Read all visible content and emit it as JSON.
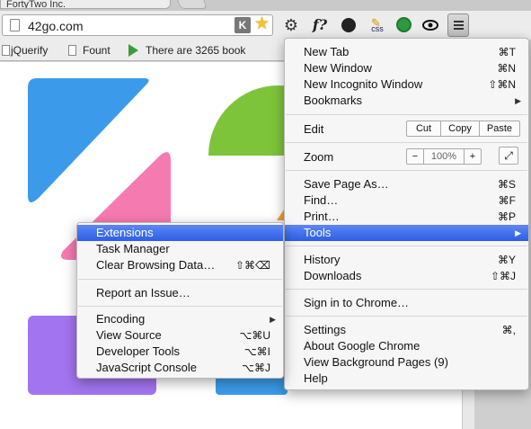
{
  "tab": {
    "title": "FortyTwo Inc.",
    "close": "×"
  },
  "omnibox": {
    "url": "42go.com",
    "k_badge": "K",
    "star": "☆"
  },
  "extensions": {
    "gear": "⚙",
    "fx": "f?",
    "css": "css",
    "eye": "👁"
  },
  "bookmarks": [
    {
      "label": "jQuerify"
    },
    {
      "label": "Fount"
    },
    {
      "label": "There are 3265 book"
    }
  ],
  "colors": {
    "blue": "#3b9bea",
    "green": "#7ec43a",
    "pink": "#f57ab0",
    "purple": "#a374f0",
    "orange": "#f6a23a",
    "highlight": "#3b6cf0"
  },
  "main_menu": {
    "new_tab": {
      "label": "New Tab",
      "shortcut": "⌘T"
    },
    "new_window": {
      "label": "New Window",
      "shortcut": "⌘N"
    },
    "new_incognito": {
      "label": "New Incognito Window",
      "shortcut": "⇧⌘N"
    },
    "bookmarks": {
      "label": "Bookmarks",
      "arrow": "▶"
    },
    "edit": {
      "label": "Edit",
      "cut": "Cut",
      "copy": "Copy",
      "paste": "Paste"
    },
    "zoom": {
      "label": "Zoom",
      "minus": "−",
      "value": "100%",
      "plus": "+",
      "fullscreen": "⤢"
    },
    "save_page": {
      "label": "Save Page As…",
      "shortcut": "⌘S"
    },
    "find": {
      "label": "Find…",
      "shortcut": "⌘F"
    },
    "print": {
      "label": "Print…",
      "shortcut": "⌘P"
    },
    "tools": {
      "label": "Tools",
      "arrow": "▶"
    },
    "history": {
      "label": "History",
      "shortcut": "⌘Y"
    },
    "downloads": {
      "label": "Downloads",
      "shortcut": "⇧⌘J"
    },
    "sign_in": {
      "label": "Sign in to Chrome…"
    },
    "settings": {
      "label": "Settings",
      "shortcut": "⌘,"
    },
    "about": {
      "label": "About Google Chrome"
    },
    "background_pages": {
      "label": "View Background Pages (9)"
    },
    "help": {
      "label": "Help"
    }
  },
  "tools_menu": {
    "extensions": {
      "label": "Extensions"
    },
    "task_manager": {
      "label": "Task Manager"
    },
    "clear_browsing": {
      "label": "Clear Browsing Data…",
      "shortcut": "⇧⌘⌫"
    },
    "report_issue": {
      "label": "Report an Issue…"
    },
    "encoding": {
      "label": "Encoding",
      "arrow": "▶"
    },
    "view_source": {
      "label": "View Source",
      "shortcut": "⌥⌘U"
    },
    "developer_tools": {
      "label": "Developer Tools",
      "shortcut": "⌥⌘I"
    },
    "js_console": {
      "label": "JavaScript Console",
      "shortcut": "⌥⌘J"
    }
  }
}
